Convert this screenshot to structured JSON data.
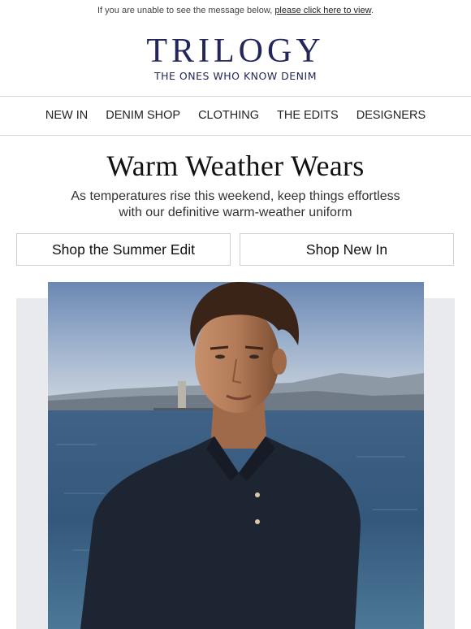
{
  "preheader": {
    "text": "If you are unable to see the message below, ",
    "link": "please click here to view",
    "suffix": "."
  },
  "brand": {
    "name": "TRILOGY",
    "tagline": "THE ONES WHO KNOW DENIM",
    "color": "#23265b"
  },
  "nav": {
    "items": [
      "NEW IN",
      "DENIM SHOP",
      "CLOTHING",
      "THE EDITS",
      "DESIGNERS"
    ]
  },
  "hero": {
    "headline": "Warm Weather Wears",
    "subline_1": "As temperatures rise this weekend, keep things effortless",
    "subline_2": "with our definitive warm-weather uniform"
  },
  "buttons": {
    "summer_edit": "Shop the Summer Edit",
    "new_in": "Shop New In"
  },
  "image": {
    "description_icon": "photo-model-polo-sea"
  }
}
